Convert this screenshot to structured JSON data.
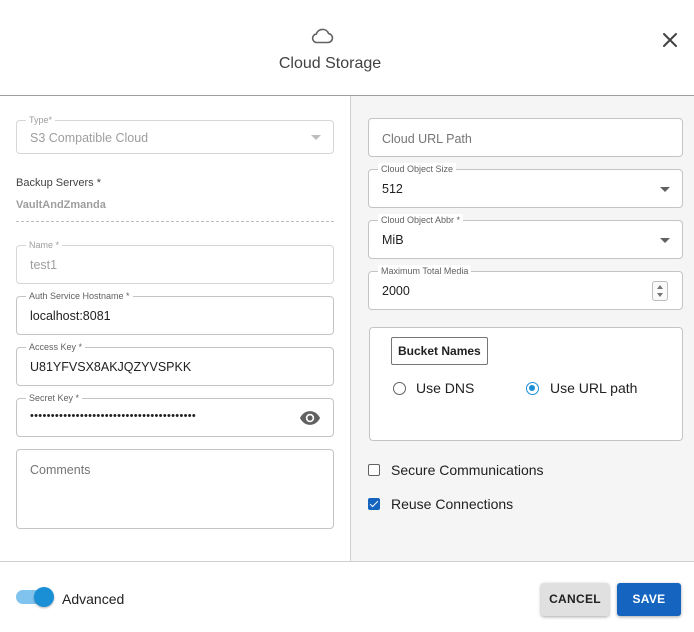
{
  "header": {
    "title": "Cloud Storage",
    "icon": "cloud-icon"
  },
  "left": {
    "type": {
      "label": "Type*",
      "value": "S3 Compatible Cloud"
    },
    "backup_servers": {
      "label": "Backup Servers *",
      "value": "VaultAndZmanda"
    },
    "name": {
      "label": "Name *",
      "value": "test1"
    },
    "auth_host": {
      "label": "Auth Service Hostname *",
      "value": "localhost:8081"
    },
    "access_key": {
      "label": "Access Key *",
      "value": "U81YFVSX8AKJQZYVSPKK"
    },
    "secret_key": {
      "label": "Secret Key *",
      "value": "••••••••••••••••••••••••••••••••••••••••"
    },
    "comments": {
      "placeholder": "Comments"
    }
  },
  "right": {
    "cloud_url_path": {
      "placeholder": "Cloud URL Path"
    },
    "object_size": {
      "label": "Cloud Object Size",
      "value": "512"
    },
    "object_abbr": {
      "label": "Cloud Object Abbr *",
      "value": "MiB"
    },
    "max_media": {
      "label": "Maximum Total Media",
      "value": "2000"
    },
    "bucket": {
      "title": "Bucket Names",
      "use_dns": "Use DNS",
      "use_url_path": "Use URL path",
      "selected": "Use URL path"
    },
    "secure_comm": {
      "label": "Secure Communications",
      "checked": false
    },
    "reuse_conn": {
      "label": "Reuse Connections",
      "checked": true
    }
  },
  "footer": {
    "advanced_label": "Advanced",
    "advanced_on": true,
    "cancel_label": "CANCEL",
    "save_label": "SAVE"
  },
  "colors": {
    "accent": "#1a8fd6",
    "primary_button": "#1565c0",
    "pane_bg": "#f5f5f5"
  }
}
